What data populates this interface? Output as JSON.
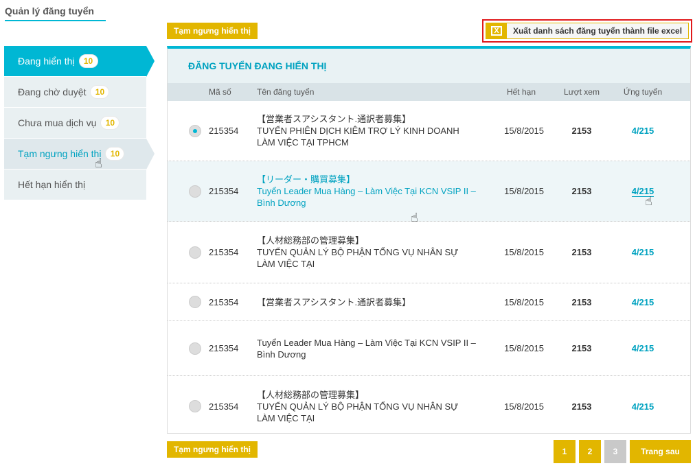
{
  "page": {
    "title": "Quản lý đăng tuyển"
  },
  "actions": {
    "suspend_top": "Tạm ngưng hiển thị",
    "suspend_bottom": "Tạm ngưng hiển thị",
    "export_excel": "Xuất danh sách đăng tuyển thành file excel",
    "excel_icon": "X"
  },
  "sidebar": {
    "items": [
      {
        "label": "Đang hiển thị",
        "count": "10"
      },
      {
        "label": "Đang chờ duyệt",
        "count": "10"
      },
      {
        "label": "Chưa mua dịch vụ",
        "count": "10"
      },
      {
        "label": "Tạm ngưng hiển thị",
        "count": "10"
      },
      {
        "label": "Hết hạn hiển thị"
      }
    ]
  },
  "panel": {
    "heading": "ĐĂNG TUYỂN ĐANG HIỂN THỊ",
    "columns": {
      "id": "Mã số",
      "title": "Tên đăng tuyển",
      "expiry": "Hết hạn",
      "views": "Lượt xem",
      "applied": "Ứng tuyển"
    },
    "rows": [
      {
        "id": "215354",
        "title_jp": "【営業者スアシスタント.通訳者募集】",
        "title": "TUYỂN PHIÊN DỊCH KIÊM TRỢ LÝ KINH DOANH LÀM VIỆC TẠI TPHCM",
        "expiry": "15/8/2015",
        "views": "2153",
        "applied": "4/215"
      },
      {
        "id": "215354",
        "title_jp": "【リーダー・購買募集】",
        "title": "Tuyển Leader Mua Hàng – Làm Việc Tại KCN VSIP II – Bình Dương",
        "expiry": "15/8/2015",
        "views": "2153",
        "applied": "4/215"
      },
      {
        "id": "215354",
        "title_jp": "【人材総務部の管理募集】",
        "title": "TUYỂN QUẢN LÝ BỘ PHẬN TỔNG VỤ NHÂN SỰ LÀM VIỆC TẠI",
        "expiry": "15/8/2015",
        "views": "2153",
        "applied": "4/215"
      },
      {
        "id": "215354",
        "title_jp": "【営業者スアシスタント.通訳者募集】",
        "title": "",
        "expiry": "15/8/2015",
        "views": "2153",
        "applied": "4/215"
      },
      {
        "id": "215354",
        "title_jp": "",
        "title": "Tuyển Leader Mua Hàng – Làm Việc Tại KCN VSIP II – Bình Dương",
        "expiry": "15/8/2015",
        "views": "2153",
        "applied": "4/215"
      },
      {
        "id": "215354",
        "title_jp": "【人材総務部の管理募集】",
        "title": "TUYỂN QUẢN LÝ BỘ PHẬN TỔNG VỤ NHÂN SỰ LÀM VIỆC TẠI",
        "expiry": "15/8/2015",
        "views": "2153",
        "applied": "4/215"
      }
    ]
  },
  "pagination": {
    "pages": [
      "1",
      "2",
      "3"
    ],
    "next": "Trang sau"
  },
  "colors": {
    "accent": "#00b7d4",
    "button": "#e2b600",
    "highlight": "#e0191b"
  }
}
